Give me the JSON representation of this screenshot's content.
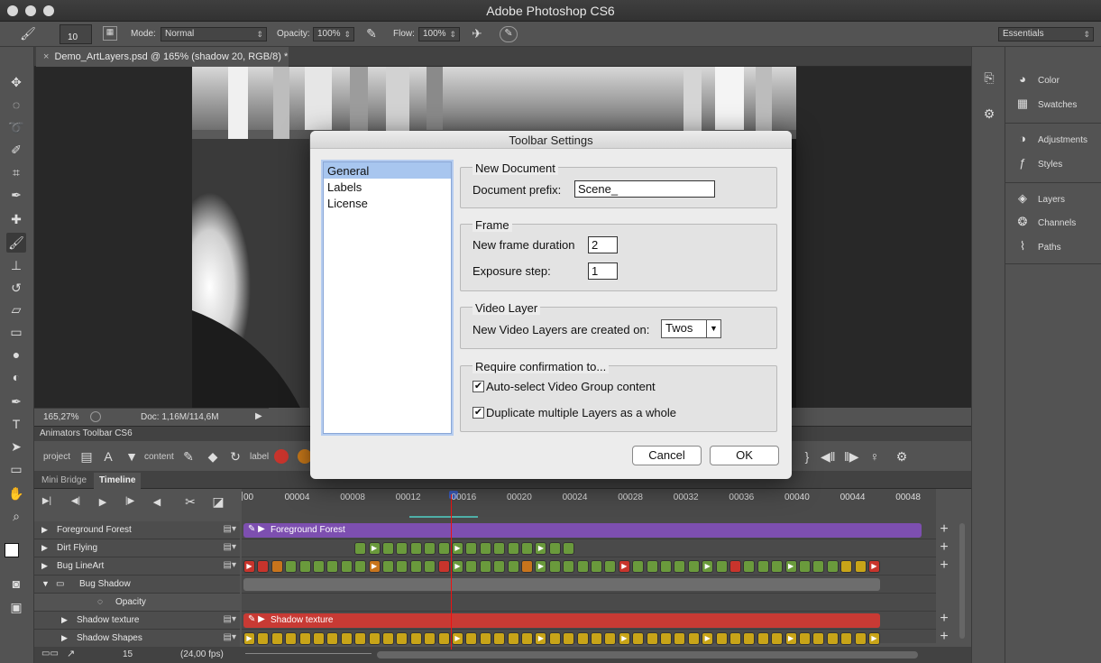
{
  "app": {
    "title": "Adobe Photoshop CS6"
  },
  "options_bar": {
    "brush_size": "10",
    "mode_label": "Mode:",
    "mode_value": "Normal",
    "opacity_label": "Opacity:",
    "opacity_value": "100%",
    "flow_label": "Flow:",
    "flow_value": "100%",
    "workspace_value": "Essentials"
  },
  "document": {
    "tab_label": "Demo_ArtLayers.psd @ 165% (shadow  20, RGB/8) *",
    "zoom": "165,27%",
    "doc_size": "Doc: 1,16M/114,6M"
  },
  "right_panels": [
    {
      "label": "Color",
      "icon": "color-palette-icon"
    },
    {
      "label": "Swatches",
      "icon": "swatches-grid-icon"
    },
    {
      "label": "Adjustments",
      "icon": "adjustments-icon"
    },
    {
      "label": "Styles",
      "icon": "styles-fx-icon"
    },
    {
      "label": "Layers",
      "icon": "layers-stack-icon"
    },
    {
      "label": "Channels",
      "icon": "channels-icon"
    },
    {
      "label": "Paths",
      "icon": "paths-icon"
    }
  ],
  "animators_panel": {
    "title": "Animators Toolbar CS6",
    "project_label": "project",
    "content_label": "content",
    "label_label": "label"
  },
  "timeline": {
    "tabs": [
      "Mini Bridge",
      "Timeline"
    ],
    "ticks": [
      "00",
      "00004",
      "00008",
      "00012",
      "00016",
      "00020",
      "00024",
      "00028",
      "00032",
      "00036",
      "00040",
      "00044",
      "00048"
    ],
    "layers": [
      {
        "name": "Foreground Forest",
        "indent": 0,
        "expanded": false
      },
      {
        "name": "Dirt Flying",
        "indent": 0,
        "expanded": false
      },
      {
        "name": "Bug LineArt",
        "indent": 0,
        "expanded": false
      },
      {
        "name": "Bug Shadow",
        "indent": 0,
        "expanded": true,
        "group": true
      },
      {
        "name": "Opacity",
        "indent": 2,
        "property": true
      },
      {
        "name": "Shadow texture",
        "indent": 1,
        "expanded": false
      },
      {
        "name": "Shadow Shapes",
        "indent": 1,
        "expanded": false
      }
    ],
    "bar_labels": {
      "foreground": "Foreground Forest",
      "shadow_texture": "Shadow texture"
    },
    "frame_number": "15",
    "fps": "(24,00 fps)"
  },
  "dialog": {
    "title": "Toolbar Settings",
    "nav": [
      "General",
      "Labels",
      "License"
    ],
    "selected_nav": "General",
    "new_document": {
      "heading": "New Document",
      "prefix_label": "Document prefix:",
      "prefix_value": "Scene_"
    },
    "frame": {
      "heading": "Frame",
      "duration_label": "New frame duration",
      "duration_value": "2",
      "step_label": "Exposure step:",
      "step_value": "1"
    },
    "video_layer": {
      "heading": "Video Layer",
      "label": "New Video Layers are created on:",
      "value": "Twos"
    },
    "confirm": {
      "heading": "Require confirmation to...",
      "opt1": "Auto-select Video Group content",
      "opt2": "Duplicate multiple Layers as a whole"
    },
    "cancel_label": "Cancel",
    "ok_label": "OK"
  },
  "colors": {
    "green_cell": "#6a9a3c",
    "orange_cell": "#c8741c",
    "red_cell": "#c8342c",
    "yellow_cell": "#c8a418",
    "purple_bar": "#7d4fb0",
    "red_bar": "#c83a34",
    "playhead": "#e11111"
  }
}
